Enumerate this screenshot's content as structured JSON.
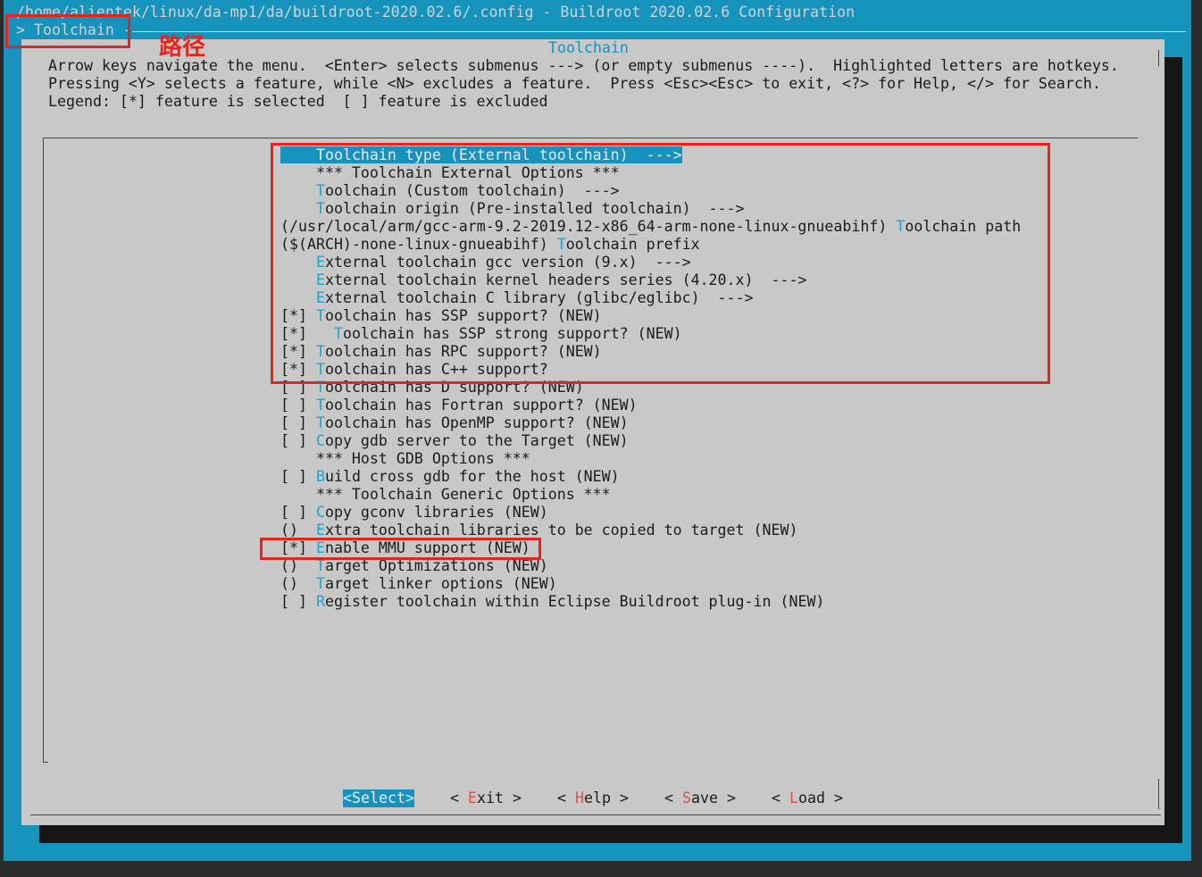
{
  "window": {
    "title_line": "/home/alientek/linux/da-mp1/da/buildroot-2020.02.6/.config - Buildroot 2020.02.6 Configuration",
    "path_line": "> Toolchain -",
    "path_annotation": "路径"
  },
  "dialog": {
    "title": "Toolchain",
    "help_lines": [
      "Arrow keys navigate the menu.  <Enter> selects submenus ---> (or empty submenus ----).  Highlighted letters are hotkeys.",
      "Pressing <Y> selects a feature, while <N> excludes a feature.  Press <Esc><Esc> to exit, <?> for Help, </> for Search.",
      "Legend: [*] feature is selected  [ ] feature is excluded"
    ]
  },
  "menu": {
    "items": [
      {
        "prefix": "    ",
        "hotkey": "T",
        "rest": "oolchain type (External toolchain)  --->",
        "selected": true
      },
      {
        "prefix": "    ",
        "hotkey": "",
        "rest": "*** Toolchain External Options ***"
      },
      {
        "prefix": "    ",
        "hotkey": "T",
        "rest": "oolchain (Custom toolchain)  --->"
      },
      {
        "prefix": "    ",
        "hotkey": "T",
        "rest": "oolchain origin (Pre-installed toolchain)  --->"
      },
      {
        "prefix": "(/usr/local/arm/gcc-arm-9.2-2019.12-x86_64-arm-none-linux-gnueabihf) ",
        "hotkey": "T",
        "rest": "oolchain path"
      },
      {
        "prefix": "($(ARCH)-none-linux-gnueabihf) ",
        "hotkey": "T",
        "rest": "oolchain prefix"
      },
      {
        "prefix": "    ",
        "hotkey": "E",
        "rest": "xternal toolchain gcc version (9.x)  --->"
      },
      {
        "prefix": "    ",
        "hotkey": "E",
        "rest": "xternal toolchain kernel headers series (4.20.x)  --->"
      },
      {
        "prefix": "    ",
        "hotkey": "E",
        "rest": "xternal toolchain C library (glibc/eglibc)  --->"
      },
      {
        "prefix": "[*] ",
        "hotkey": "T",
        "rest": "oolchain has SSP support? (NEW)"
      },
      {
        "prefix": "[*]   ",
        "hotkey": "T",
        "rest": "oolchain has SSP strong support? (NEW)"
      },
      {
        "prefix": "[*] ",
        "hotkey": "T",
        "rest": "oolchain has RPC support? (NEW)"
      },
      {
        "prefix": "[*] ",
        "hotkey": "T",
        "rest": "oolchain has C++ support?"
      },
      {
        "prefix": "[ ] ",
        "hotkey": "T",
        "rest": "oolchain has D support? (NEW)"
      },
      {
        "prefix": "[ ] ",
        "hotkey": "T",
        "rest": "oolchain has Fortran support? (NEW)"
      },
      {
        "prefix": "[ ] ",
        "hotkey": "T",
        "rest": "oolchain has OpenMP support? (NEW)"
      },
      {
        "prefix": "[ ] ",
        "hotkey": "C",
        "rest": "opy gdb server to the Target (NEW)"
      },
      {
        "prefix": "    ",
        "hotkey": "",
        "rest": "*** Host GDB Options ***"
      },
      {
        "prefix": "[ ] ",
        "hotkey": "B",
        "rest": "uild cross gdb for the host (NEW)"
      },
      {
        "prefix": "    ",
        "hotkey": "",
        "rest": "*** Toolchain Generic Options ***"
      },
      {
        "prefix": "[ ] ",
        "hotkey": "C",
        "rest": "opy gconv libraries (NEW)"
      },
      {
        "prefix": "()  ",
        "hotkey": "E",
        "rest": "xtra toolchain libraries to be copied to target (NEW)"
      },
      {
        "prefix": "[*] ",
        "hotkey": "E",
        "rest": "nable MMU support (NEW)"
      },
      {
        "prefix": "()  ",
        "hotkey": "T",
        "rest": "arget Optimizations (NEW)"
      },
      {
        "prefix": "()  ",
        "hotkey": "T",
        "rest": "arget linker options (NEW)"
      },
      {
        "prefix": "[ ] ",
        "hotkey": "R",
        "rest": "egister toolchain within Eclipse Buildroot plug-in (NEW)"
      }
    ]
  },
  "buttons": [
    {
      "id": "select",
      "open": "<",
      "hotkey": "S",
      "rest": "elect",
      "close": ">",
      "active": true
    },
    {
      "id": "exit",
      "open": "< ",
      "hotkey": "E",
      "rest": "xit",
      "close": " >"
    },
    {
      "id": "help",
      "open": "< ",
      "hotkey": "H",
      "rest": "elp",
      "close": " >"
    },
    {
      "id": "save",
      "open": "< ",
      "hotkey": "S",
      "rest": "ave",
      "close": " >"
    },
    {
      "id": "load",
      "open": "< ",
      "hotkey": "L",
      "rest": "oad",
      "close": " >"
    }
  ],
  "colors": {
    "terminal_bg": "#1693bd",
    "dialog_bg": "#c8c8c8",
    "hotkey": "#1aa6d1",
    "button_hotkey": "#d6524e",
    "annotation_red": "#e8231c"
  }
}
